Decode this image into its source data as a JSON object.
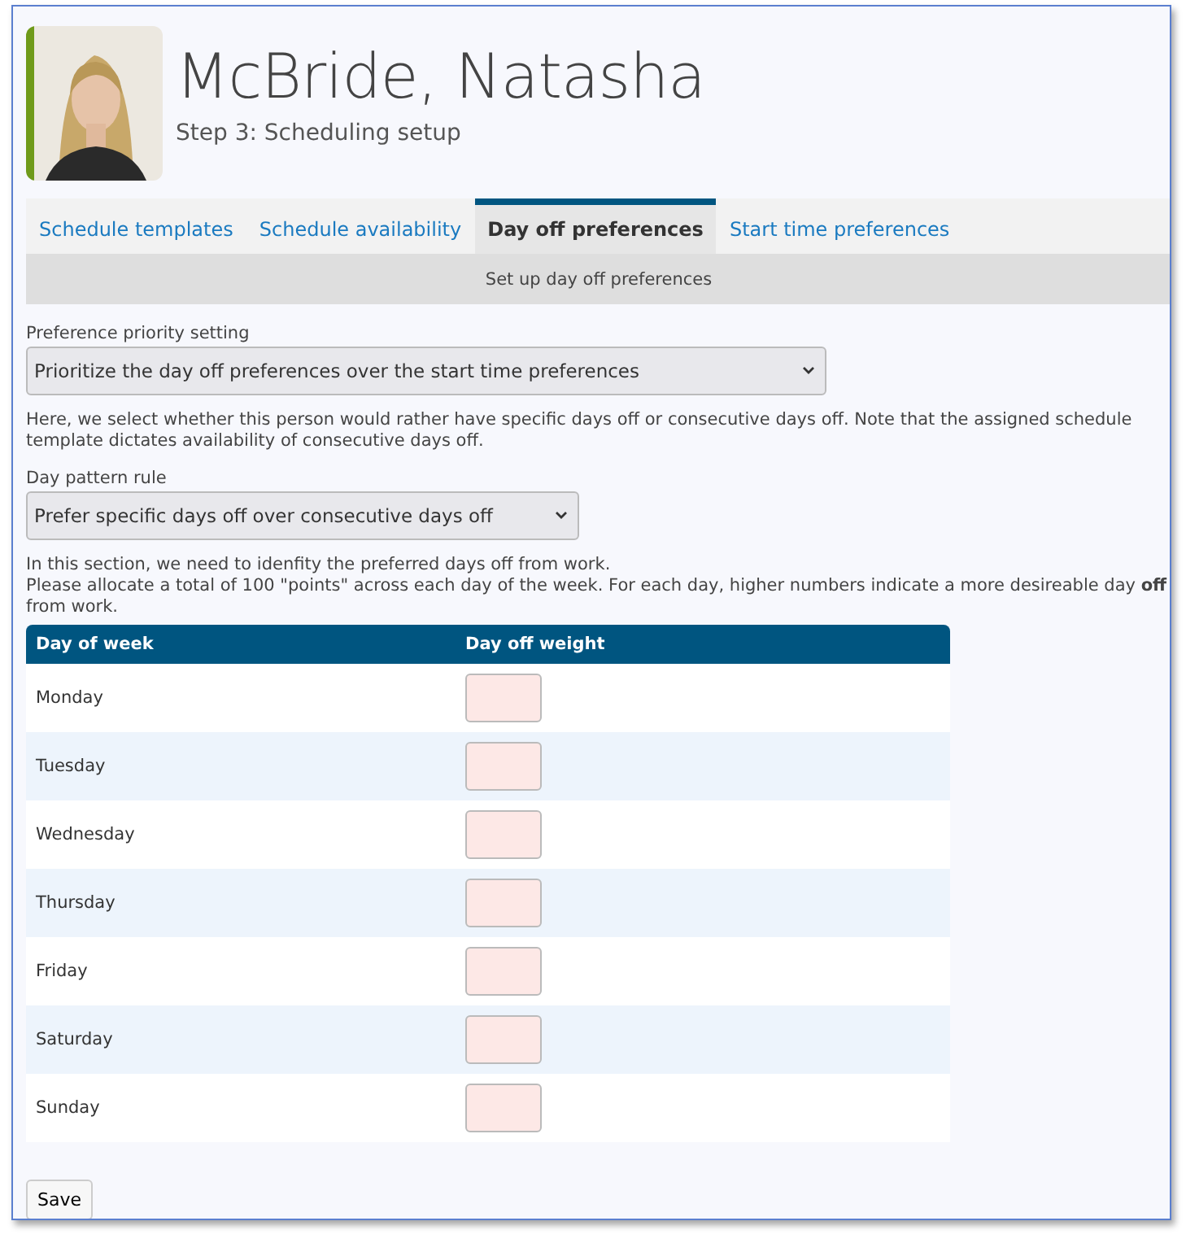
{
  "header": {
    "name": "McBride, Natasha",
    "subtitle": "Step 3: Scheduling setup"
  },
  "tabs": [
    {
      "label": "Schedule templates",
      "selected": false
    },
    {
      "label": "Schedule availability",
      "selected": false
    },
    {
      "label": "Day off preferences",
      "selected": true
    },
    {
      "label": "Start time preferences",
      "selected": false
    }
  ],
  "section_title": "Set up day off preferences",
  "priority": {
    "label": "Preference priority setting",
    "value": "Prioritize the day off preferences over the start time preferences"
  },
  "priority_note": [
    "Here, we select whether this person would rather have specific days off or consecutive days off. Note that the assigned schedule template dictates availability of consecutive days off."
  ],
  "pattern": {
    "label": "Day pattern rule",
    "value": "Prefer specific days off over consecutive days off"
  },
  "pattern_note": [
    "In this section, we need to idenfity the preferred days off from work.",
    "Please allocate a total of 100 \"points\" across each day of the week. For each day, higher numbers indicate a more desireable day **off** from work."
  ],
  "table": {
    "columns": [
      "Day of week",
      "Day off weight"
    ],
    "rows": [
      {
        "day": "Monday"
      },
      {
        "day": "Tuesday"
      },
      {
        "day": "Wednesday"
      },
      {
        "day": "Thursday"
      },
      {
        "day": "Friday"
      },
      {
        "day": "Saturday"
      },
      {
        "day": "Sunday"
      }
    ]
  },
  "buttons": [
    "Save"
  ]
}
